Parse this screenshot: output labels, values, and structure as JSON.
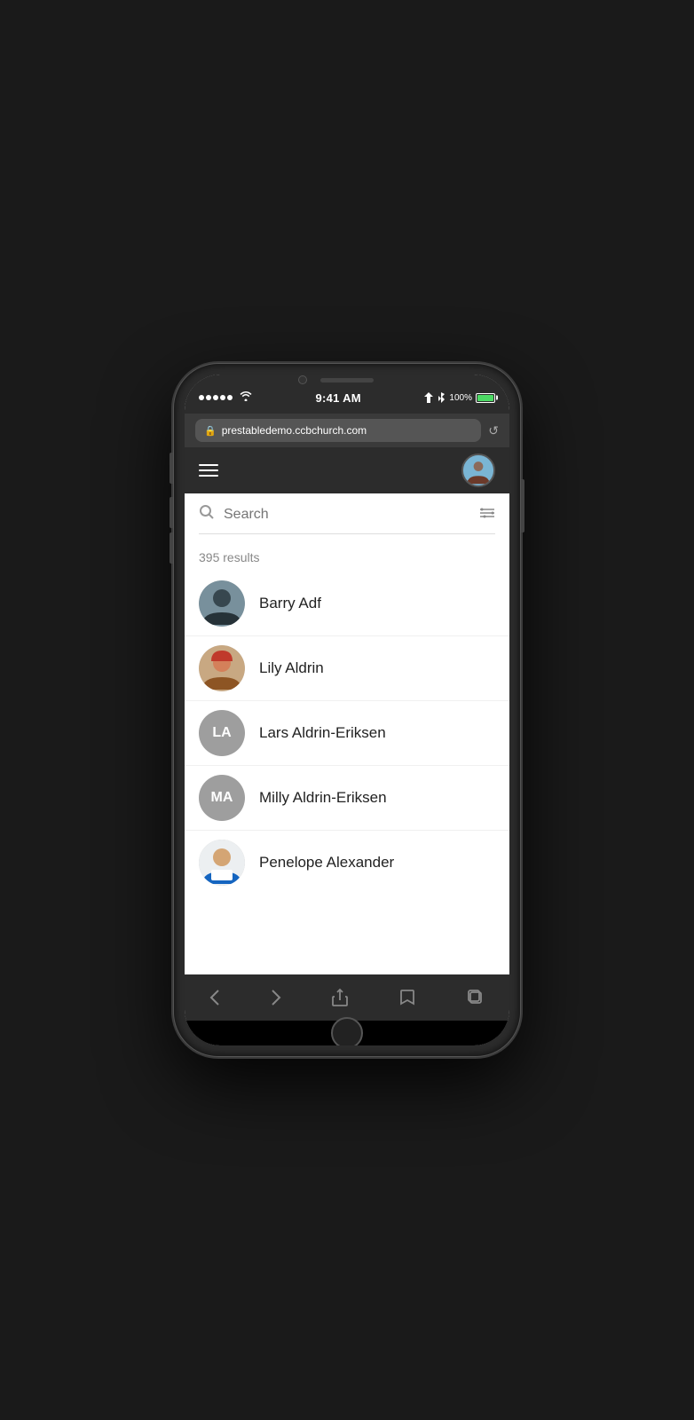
{
  "status_bar": {
    "time": "9:41 AM",
    "battery_percent": "100%",
    "url": "prestabledemo.ccbchurch.com"
  },
  "search": {
    "placeholder": "Search",
    "results_count": "395 results"
  },
  "people": [
    {
      "name": "Barry Adf",
      "initials": "",
      "avatar_type": "photo",
      "avatar_color": "#b0bec5"
    },
    {
      "name": "Lily Aldrin",
      "initials": "",
      "avatar_type": "photo",
      "avatar_color": "#c8a882"
    },
    {
      "name": "Lars Aldrin-Eriksen",
      "initials": "LA",
      "avatar_type": "initials",
      "avatar_color": "#9e9e9e"
    },
    {
      "name": "Milly Aldrin-Eriksen",
      "initials": "MA",
      "avatar_type": "initials",
      "avatar_color": "#9e9e9e"
    },
    {
      "name": "Penelope Alexander",
      "initials": "",
      "avatar_type": "photo",
      "avatar_color": "#b0bec5"
    }
  ]
}
